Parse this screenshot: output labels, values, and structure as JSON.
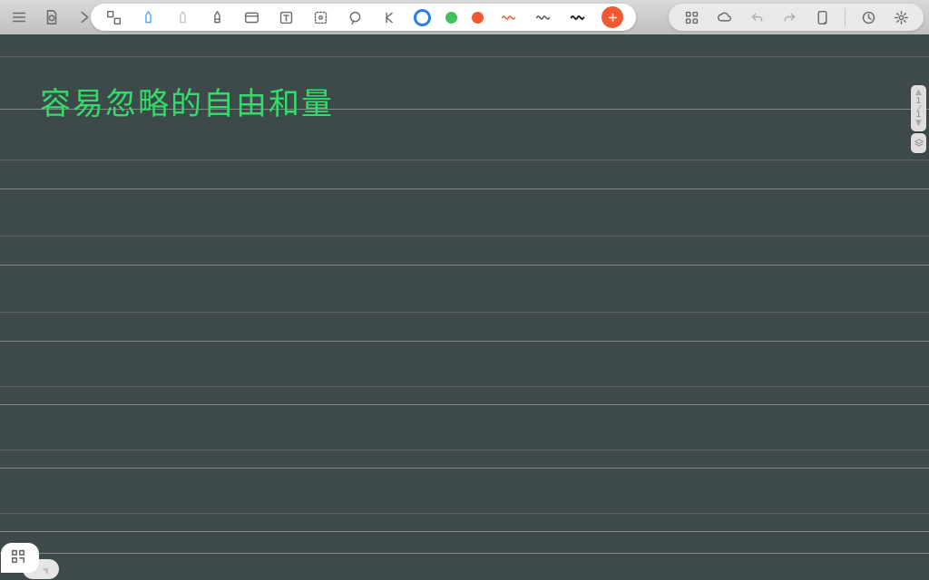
{
  "handwriting": "容易忽略的自由和量",
  "page": {
    "current": "1",
    "total": "1"
  },
  "colors": {
    "blue": "#2b7de9",
    "green": "#3cc45a",
    "red": "#f05a32",
    "ink": "#34db6b",
    "board": "#3e4a49"
  },
  "toolbar_left": {
    "menu": "menu-icon",
    "file": "file-icon",
    "next": "next-icon"
  },
  "pill_tools": {
    "shapes": "shapes-icon",
    "pen": "pen-icon",
    "highlighter": "highlighter-icon",
    "marker": "marker-icon",
    "card": "card-icon",
    "text": "text-icon",
    "frame": "frame-icon",
    "loop": "loop-icon",
    "cut": "cut-icon",
    "color_blue": "blue",
    "color_green": "green",
    "color_red": "red",
    "wave_red": "wave-icon",
    "wave_thin": "wave-icon",
    "wave_bold": "wave-icon",
    "add": "add-icon"
  },
  "toolbar_right": {
    "apps": "apps-icon",
    "cloud": "cloud-icon",
    "undo": "undo-icon",
    "redo": "redo-icon",
    "tablet": "tablet-icon",
    "clock": "clock-icon",
    "settings": "settings-icon"
  },
  "corner": {
    "qr": "qr-icon"
  },
  "side": {
    "layers": "layers-icon"
  }
}
